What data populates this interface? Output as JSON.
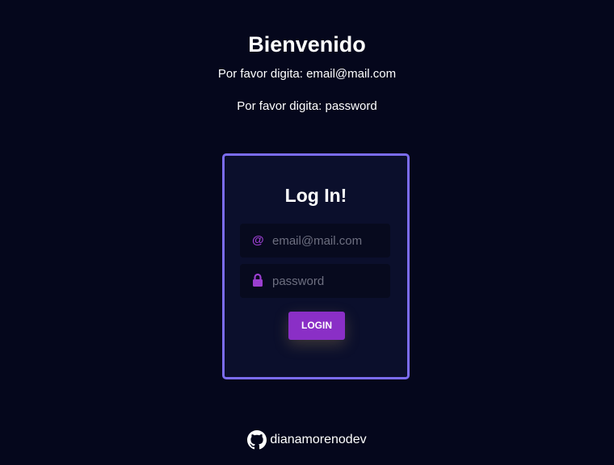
{
  "header": {
    "title": "Bienvenido",
    "hint_email": "Por favor digita: email@mail.com",
    "hint_password": "Por favor digita: password"
  },
  "login_card": {
    "title": "Log In!",
    "email_icon": "at-icon",
    "email_placeholder": "email@mail.com",
    "password_icon": "lock-icon",
    "password_placeholder": "password",
    "button_label": "LOGIN"
  },
  "footer": {
    "icon": "github-icon",
    "username": "dianamorenodev"
  },
  "colors": {
    "background": "#05071c",
    "card_border": "#7b6cf0",
    "accent": "#8a2fc6"
  }
}
